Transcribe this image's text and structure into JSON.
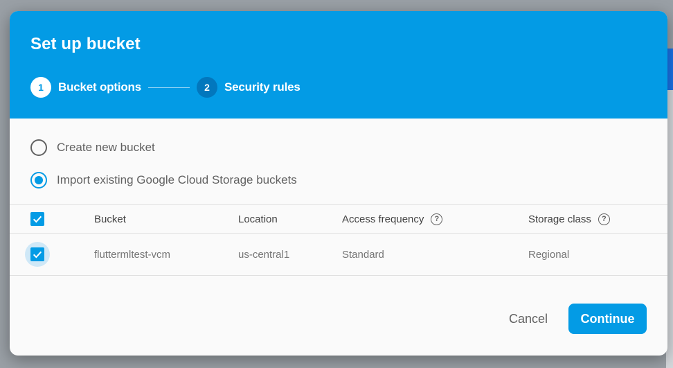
{
  "dialog": {
    "title": "Set up bucket"
  },
  "stepper": {
    "steps": [
      {
        "number": "1",
        "label": "Bucket options",
        "state": "active"
      },
      {
        "number": "2",
        "label": "Security rules",
        "state": "inactive"
      }
    ]
  },
  "options": {
    "create_new": {
      "label": "Create new bucket",
      "checked": false
    },
    "import_existing": {
      "label": "Import existing Google Cloud Storage buckets",
      "checked": true
    }
  },
  "table": {
    "headers": {
      "bucket": "Bucket",
      "location": "Location",
      "access_frequency": "Access frequency",
      "storage_class": "Storage class"
    },
    "rows": [
      {
        "bucket": "fluttermltest-vcm",
        "location": "us-central1",
        "access_frequency": "Standard",
        "storage_class": "Regional",
        "selected": true
      }
    ]
  },
  "actions": {
    "cancel_label": "Cancel",
    "continue_label": "Continue"
  },
  "colors": {
    "accent": "#039be5",
    "header_bg": "#039be5",
    "step_inactive_bg": "#0277bd"
  },
  "icons": {
    "help": "help-circle-icon",
    "check": "check-icon"
  }
}
